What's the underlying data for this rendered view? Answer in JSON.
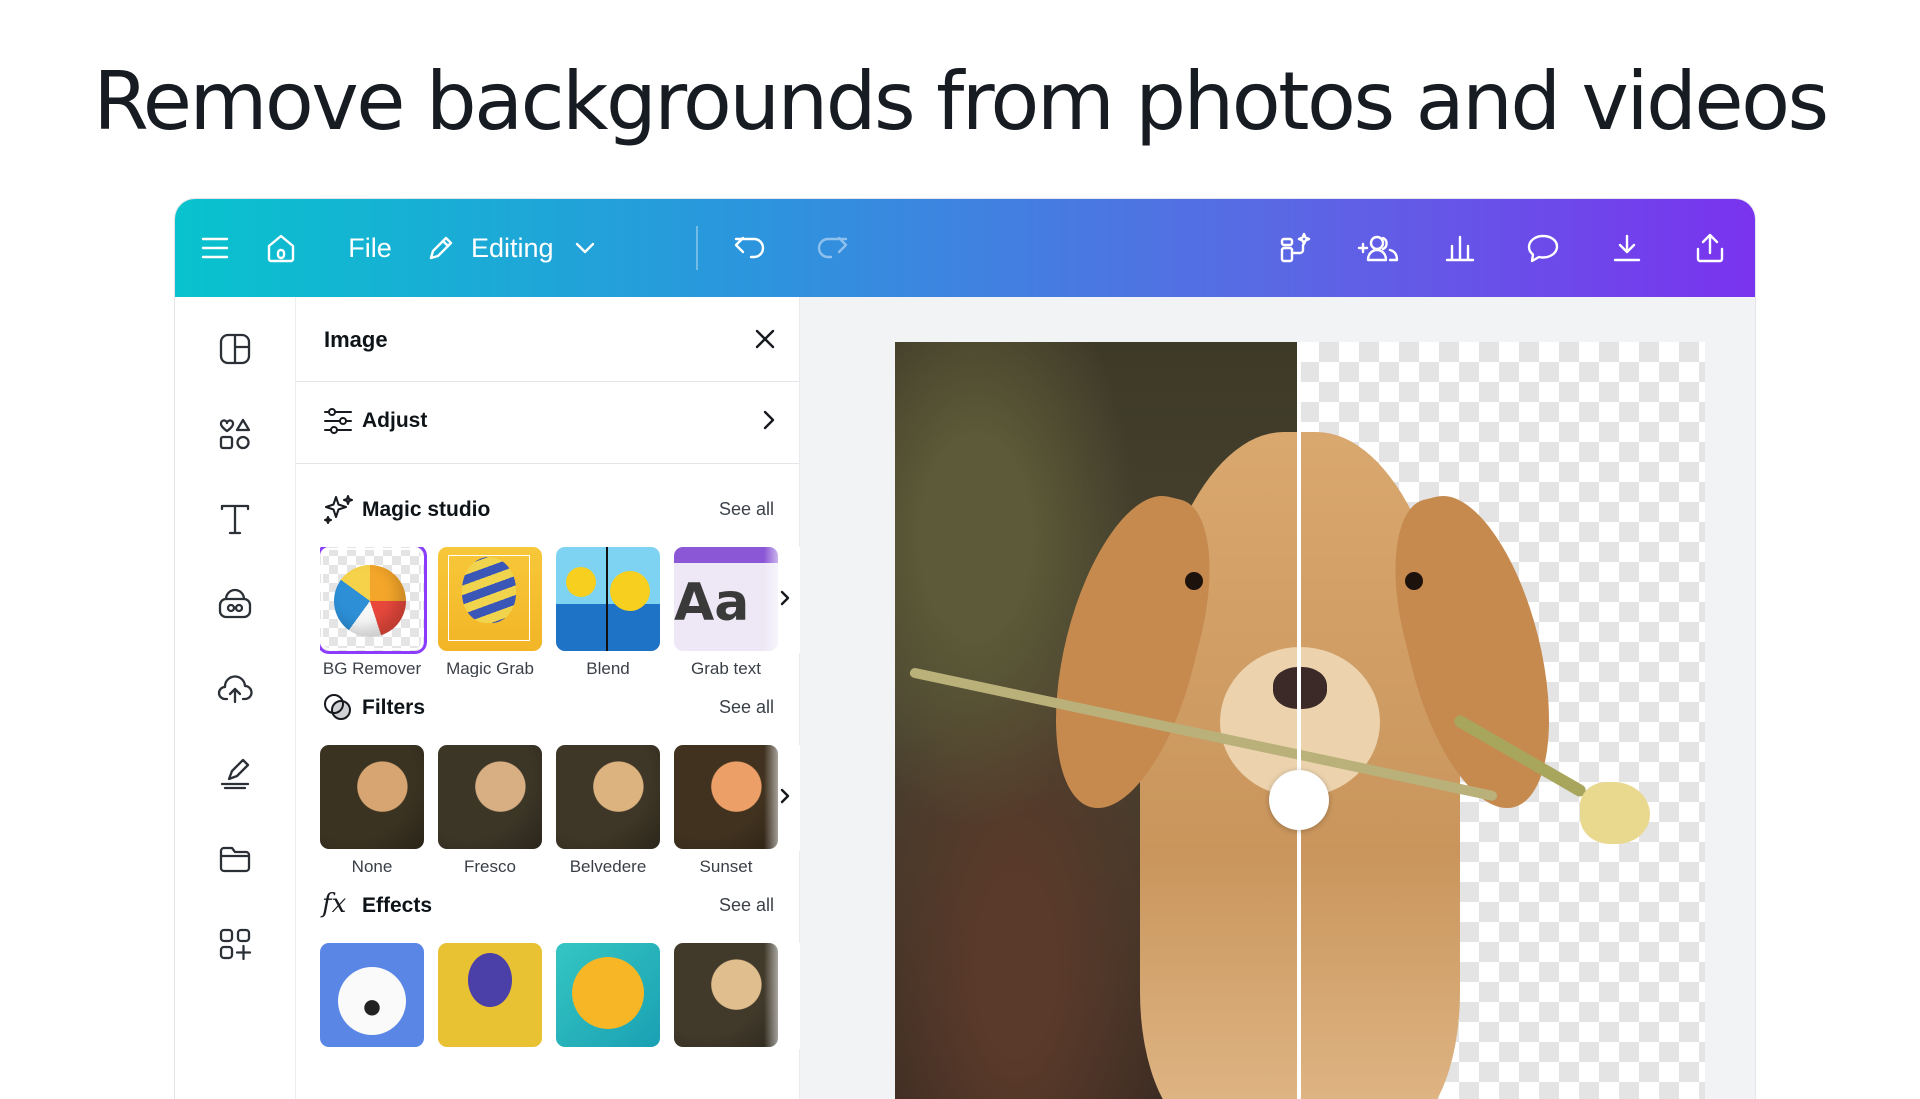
{
  "headline": "Remove backgrounds from photos and videos",
  "toolbar": {
    "file_label": "File",
    "mode_label": "Editing"
  },
  "panel": {
    "title": "Image",
    "adjust_label": "Adjust",
    "sections": {
      "magic_studio": {
        "title": "Magic studio",
        "see_all": "See all",
        "items": [
          "BG Remover",
          "Magic Grab",
          "Blend",
          "Grab text"
        ]
      },
      "filters": {
        "title": "Filters",
        "see_all": "See all",
        "items": [
          "None",
          "Fresco",
          "Belvedere",
          "Sunset"
        ]
      },
      "effects": {
        "title": "Effects",
        "see_all": "See all"
      }
    }
  },
  "colors": {
    "gradient_start": "#08c3cd",
    "gradient_end": "#7a33ee",
    "selection": "#8b3dff"
  },
  "icons": {
    "toolbar": [
      "menu-icon",
      "home-icon",
      "pencil-icon",
      "chevron-down-icon",
      "undo-icon",
      "redo-icon",
      "magic-resize-icon",
      "share-people-icon",
      "insights-icon",
      "comment-icon",
      "download-icon",
      "upload-icon"
    ],
    "rail": [
      "templates-icon",
      "elements-icon",
      "text-icon",
      "brand-icon",
      "uploads-icon",
      "draw-icon",
      "projects-icon",
      "apps-icon"
    ]
  }
}
